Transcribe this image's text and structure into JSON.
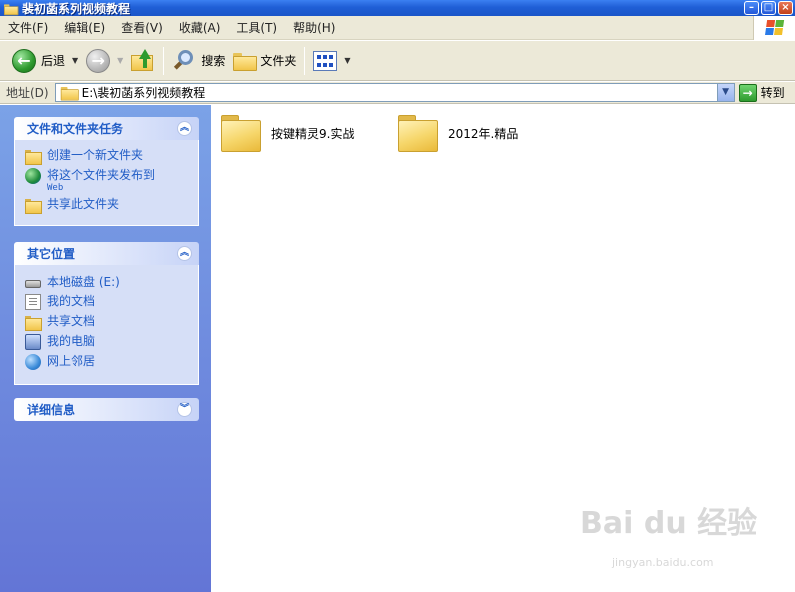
{
  "window": {
    "title": "裴初菡系列视频教程"
  },
  "menu": [
    "文件(F)",
    "编辑(E)",
    "查看(V)",
    "收藏(A)",
    "工具(T)",
    "帮助(H)"
  ],
  "toolbar": {
    "back_label": "后退",
    "search_label": "搜索",
    "folders_label": "文件夹"
  },
  "address": {
    "label": "地址(D)",
    "value": "E:\\裴初菡系列视频教程",
    "go_label": "转到"
  },
  "tasks_panel": {
    "title": "文件和文件夹任务",
    "items": [
      {
        "label": "创建一个新文件夹",
        "icon": "new-folder-icon"
      },
      {
        "label": "将这个文件夹发布到",
        "sub": "Web",
        "icon": "web-publish-icon"
      },
      {
        "label": "共享此文件夹",
        "icon": "share-folder-icon"
      }
    ]
  },
  "places_panel": {
    "title": "其它位置",
    "items": [
      {
        "label": "本地磁盘 (E:)",
        "icon": "disk-icon"
      },
      {
        "label": "我的文档",
        "icon": "my-documents-icon"
      },
      {
        "label": "共享文档",
        "icon": "shared-documents-icon"
      },
      {
        "label": "我的电脑",
        "icon": "my-computer-icon"
      },
      {
        "label": "网上邻居",
        "icon": "network-icon"
      }
    ]
  },
  "details_panel": {
    "title": "详细信息"
  },
  "files": [
    {
      "name": "按键精灵9.实战"
    },
    {
      "name": "2012年.精品"
    }
  ],
  "watermark": {
    "brand": "Bai du 经验",
    "url": "jingyan.baidu.com"
  },
  "colors": {
    "titlebar": "#1f5fd6",
    "taskpane": "#6375d6",
    "link": "#215dc6"
  }
}
